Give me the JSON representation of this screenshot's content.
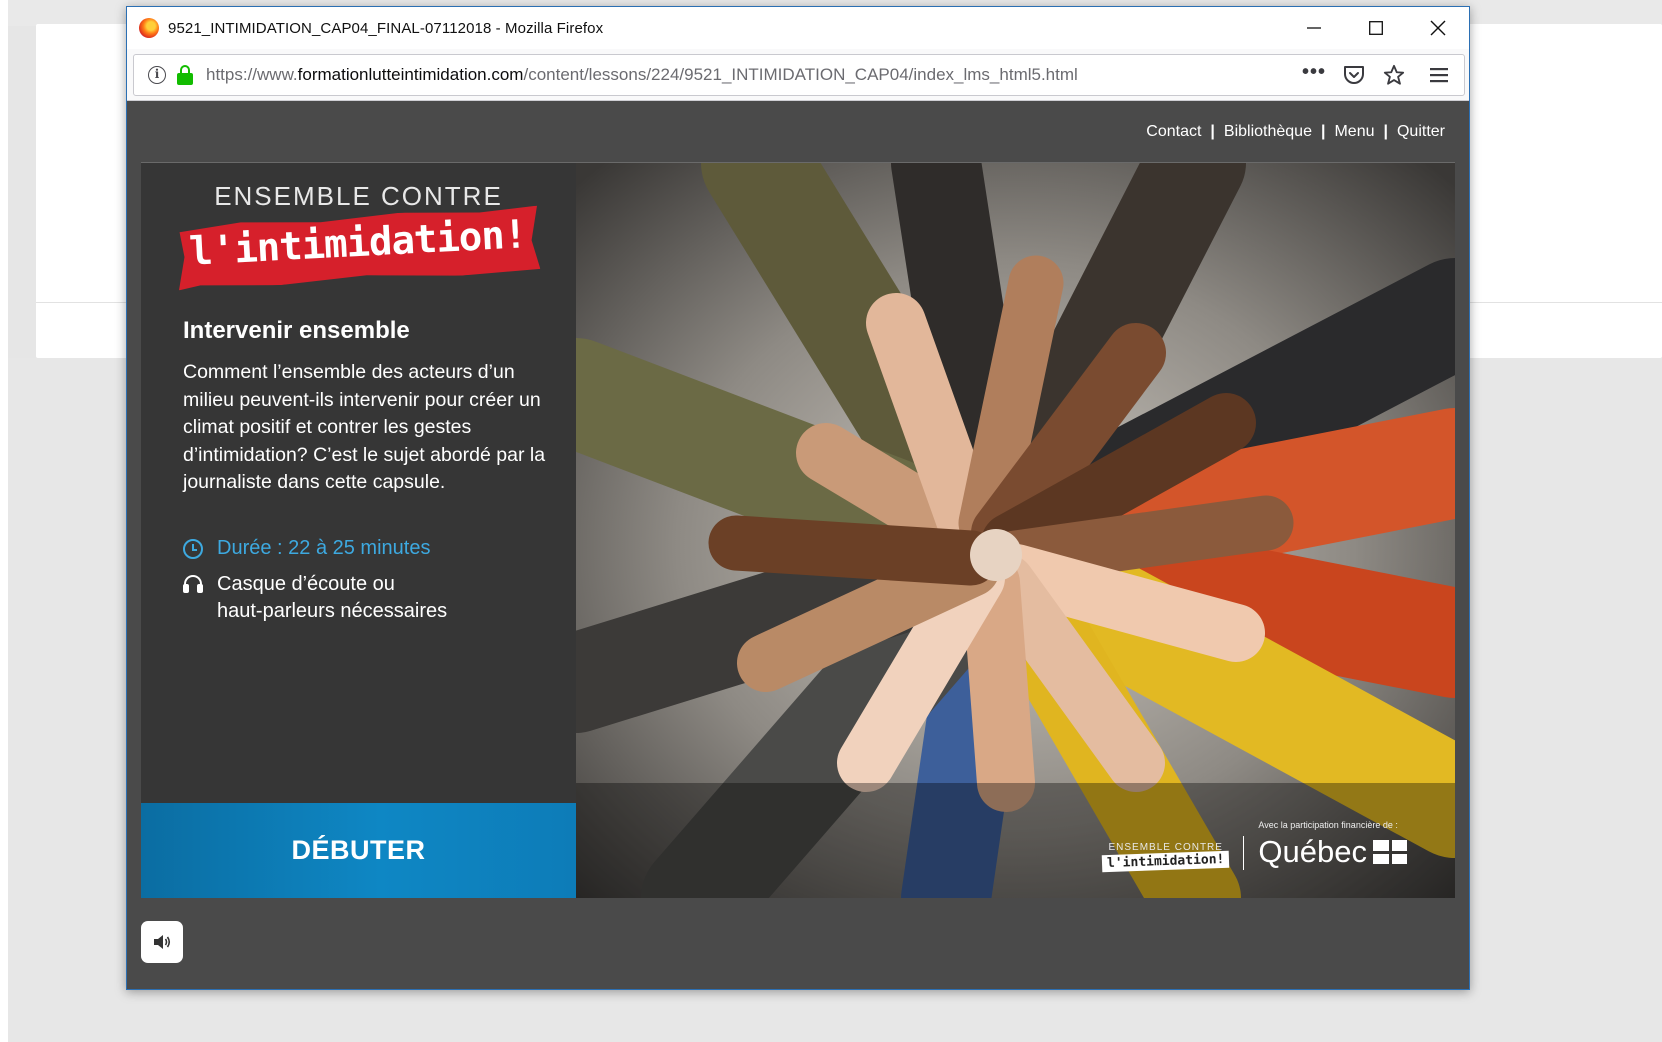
{
  "window": {
    "title": "9521_INTIMIDATION_CAP04_FINAL-07112018 - Mozilla Firefox",
    "controls": {
      "minimize": "—",
      "close": "✕"
    }
  },
  "browser": {
    "url_prefix": "https://www.",
    "url_domain": "formationlutteintimidation.com",
    "url_path": "/content/lessons/224/9521_INTIMIDATION_CAP04/index_lms_html5.html",
    "more_label": "•••",
    "icons": [
      "info-icon",
      "lock-icon",
      "more-icon",
      "pocket-icon",
      "star-icon",
      "menu-icon"
    ]
  },
  "top_links": {
    "contact": "Contact",
    "bibliotheque": "Bibliothèque",
    "menu": "Menu",
    "quitter": "Quitter",
    "separator": "|"
  },
  "course": {
    "brand_top": "ENSEMBLE CONTRE",
    "brand_logo": "l'intimidation!",
    "heading": "Intervenir ensemble",
    "description": "Comment l’ensemble des acteurs d’un milieu peuvent-ils intervenir pour créer un climat positif et contrer les gestes d’intimidation? C’est le sujet abordé par la journaliste dans cette capsule.",
    "duration": "Durée : 22 à 25 minutes",
    "headphones_line1": "Casque d’écoute ou",
    "headphones_line2": "haut-parleurs nécessaires",
    "start_button": "DÉBUTER"
  },
  "photo_logos": {
    "mini_top": "ENSEMBLE CONTRE",
    "mini_logo": "l'intimidation!",
    "avec": "Avec la participation financière de :",
    "quebec": "Québec"
  },
  "colors": {
    "accent_blue": "#3da9e0",
    "button_blue": "#0e87c4",
    "logo_red": "#d6202b",
    "panel_dark": "#363636",
    "frame_gray": "#4a4a4a"
  }
}
